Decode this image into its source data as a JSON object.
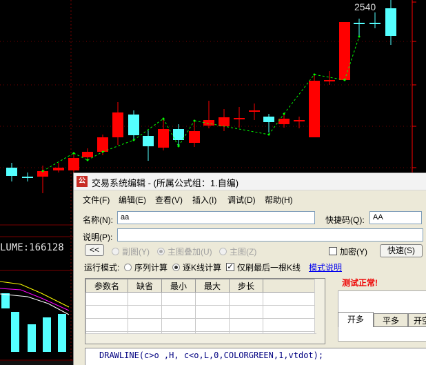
{
  "chart": {
    "price_label": "2540",
    "volume_label": "LUME:166128",
    "up_color": "#ff0000",
    "down_color": "#54ffff",
    "line_color": "#00ff00",
    "axis_color": "#ff0000"
  },
  "window": {
    "icon_text": "公",
    "title": "交易系统编辑 - (所属公式组：1.自编)"
  },
  "menu": [
    "文件(F)",
    "编辑(E)",
    "查看(V)",
    "插入(I)",
    "调试(D)",
    "帮助(H)"
  ],
  "form": {
    "name_label": "名称(N):",
    "name_value": "aa",
    "shortcut_label": "快捷码(Q):",
    "shortcut_value": "AA",
    "desc_label": "说明(P):",
    "desc_value": "",
    "back_button": "<<",
    "radio_subchart": "副图(Y)",
    "radio_main_overlay": "主图叠加(U)",
    "radio_main": "主图(Z)",
    "encrypt_label": "加密(Y)",
    "quick_button": "快速(S)",
    "run_mode_label": "运行模式:",
    "mode_sequence": "序列计算",
    "mode_bar": "逐K线计算",
    "only_last_bar": "仅刷最后一根K线",
    "mode_help_link": "模式说明"
  },
  "params": {
    "headers": [
      "参数名",
      "缺省",
      "最小",
      "最大",
      "步长"
    ]
  },
  "status": "测试正常!",
  "tabs": [
    "开多",
    "平多",
    "开空"
  ],
  "code": "DRAWLINE(c>o ,H,  c<o,L,0,COLORGREEN,1,vtdot);"
}
